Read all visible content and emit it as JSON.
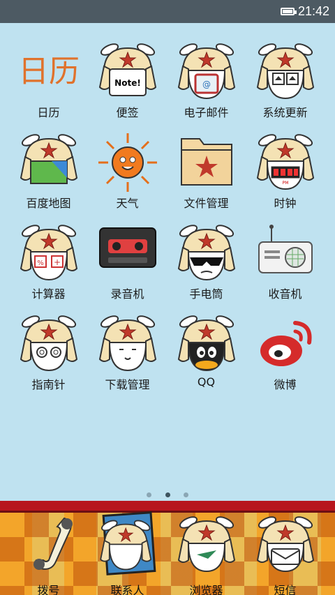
{
  "status_bar": {
    "time": "21:42"
  },
  "apps": [
    {
      "label": "日历",
      "icon": "calendar-icon"
    },
    {
      "label": "便签",
      "icon": "notes-icon"
    },
    {
      "label": "电子邮件",
      "icon": "email-icon"
    },
    {
      "label": "系统更新",
      "icon": "system-update-icon"
    },
    {
      "label": "百度地图",
      "icon": "baidu-map-icon"
    },
    {
      "label": "天气",
      "icon": "weather-icon"
    },
    {
      "label": "文件管理",
      "icon": "file-manager-icon"
    },
    {
      "label": "时钟",
      "icon": "clock-icon"
    },
    {
      "label": "计算器",
      "icon": "calculator-icon"
    },
    {
      "label": "录音机",
      "icon": "recorder-icon"
    },
    {
      "label": "手电筒",
      "icon": "flashlight-icon"
    },
    {
      "label": "收音机",
      "icon": "radio-icon"
    },
    {
      "label": "指南针",
      "icon": "compass-icon"
    },
    {
      "label": "下载管理",
      "icon": "download-manager-icon"
    },
    {
      "label": "QQ",
      "icon": "qq-icon"
    },
    {
      "label": "微博",
      "icon": "weibo-icon"
    }
  ],
  "calendar_icon_text": "日历",
  "notes_icon_text": "Note!",
  "clock_icon_text": "PM",
  "page_indicator": {
    "total": 3,
    "active_index": 1
  },
  "dock": [
    {
      "label": "拨号",
      "icon": "phone-icon"
    },
    {
      "label": "联系人",
      "icon": "contacts-icon"
    },
    {
      "label": "浏览器",
      "icon": "browser-icon"
    },
    {
      "label": "短信",
      "icon": "sms-icon"
    }
  ]
}
